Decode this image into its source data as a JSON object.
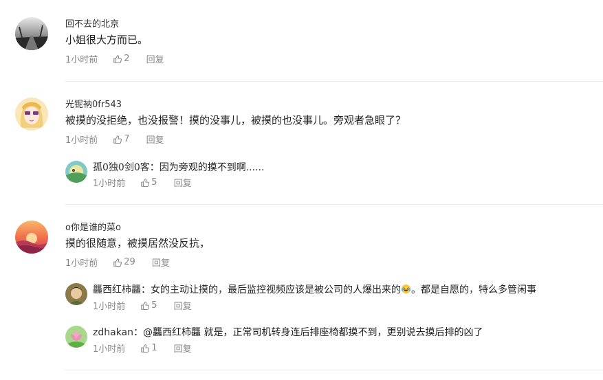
{
  "comments": [
    {
      "username": "回不去的北京",
      "text": "小姐很大方而已。",
      "time": "1小时前",
      "likes": "2",
      "reply_label": "回复",
      "replies": []
    },
    {
      "username": "光铌衲0fr543",
      "text": "被摸的没拒绝，也没报警！摸的没事儿，被摸的也没事儿。旁观者急眼了？",
      "time": "1小时前",
      "likes": "7",
      "reply_label": "回复",
      "replies": [
        {
          "username": "孤0独0剑0客",
          "separator": "：",
          "text": "因为旁观的摸不到啊......",
          "time": "1小时前",
          "likes": "5",
          "reply_label": "回复"
        }
      ]
    },
    {
      "username": "o你是谁的菜o",
      "text": "摸的很随意，被摸居然没反抗，",
      "time": "1小时前",
      "likes": "29",
      "reply_label": "回复",
      "replies": [
        {
          "username": "龘西红柿龘",
          "separator": "：",
          "text": "女的主动让摸的，最后监控视频应该是被公司的人爆出来的",
          "text_after": "。都是自愿的，特么多管闲事",
          "emoji": "laughing-crying-emoji",
          "time": "1小时前",
          "likes": "5",
          "reply_label": "回复"
        },
        {
          "username": "zdhakan",
          "separator": "：",
          "text": "@龘西红柿龘 就是，正常司机转身连后排座椅都摸不到，更别说去摸后排的凶了",
          "time": "1小时前",
          "likes": "1",
          "reply_label": "回复"
        }
      ]
    }
  ],
  "colors": {
    "meta": "#888888",
    "divider": "#ececec",
    "text": "#222222"
  }
}
